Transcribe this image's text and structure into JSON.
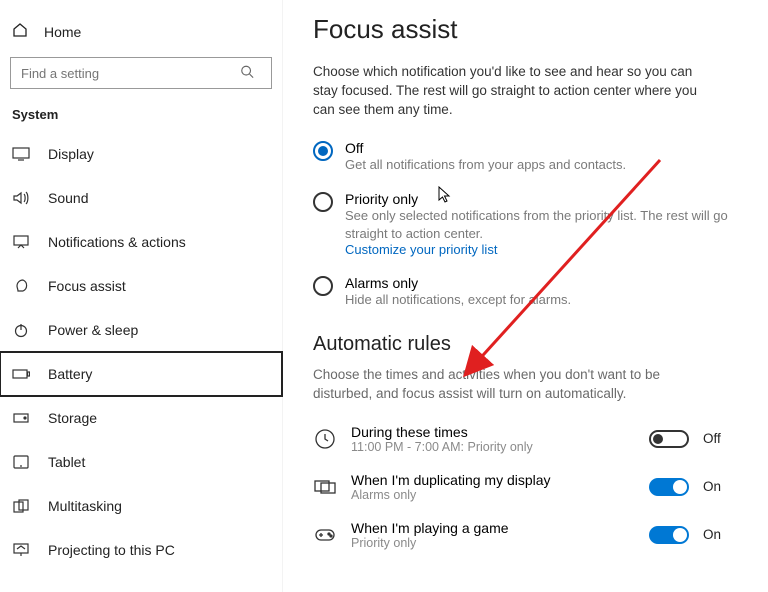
{
  "sidebar": {
    "home": "Home",
    "search_placeholder": "Find a setting",
    "section": "System",
    "items": [
      {
        "id": "display",
        "label": "Display"
      },
      {
        "id": "sound",
        "label": "Sound"
      },
      {
        "id": "notifications",
        "label": "Notifications & actions"
      },
      {
        "id": "focus-assist",
        "label": "Focus assist"
      },
      {
        "id": "power-sleep",
        "label": "Power & sleep"
      },
      {
        "id": "battery",
        "label": "Battery"
      },
      {
        "id": "storage",
        "label": "Storage"
      },
      {
        "id": "tablet",
        "label": "Tablet"
      },
      {
        "id": "multitasking",
        "label": "Multitasking"
      },
      {
        "id": "projecting",
        "label": "Projecting to this PC"
      }
    ],
    "selected": "battery"
  },
  "page": {
    "title": "Focus assist",
    "intro": "Choose which notification you'd like to see and hear so you can stay focused. The rest will go straight to action center where you can see them any time.",
    "radios": {
      "off": {
        "title": "Off",
        "desc": "Get all notifications from your apps and contacts."
      },
      "priority": {
        "title": "Priority only",
        "desc": "See only selected notifications from the priority list. The rest will go straight to action center.",
        "link": "Customize your priority list"
      },
      "alarms": {
        "title": "Alarms only",
        "desc": "Hide all notifications, except for alarms."
      },
      "selected": "off"
    },
    "rules_heading": "Automatic rules",
    "rules_intro": "Choose the times and activities when you don't want to be disturbed, and focus assist will turn on automatically.",
    "rules": {
      "times": {
        "title": "During these times",
        "sub": "11:00 PM - 7:00 AM: Priority only",
        "state": "Off"
      },
      "duplicating": {
        "title": "When I'm duplicating my display",
        "sub": "Alarms only",
        "state": "On"
      },
      "game": {
        "title": "When I'm playing a game",
        "sub": "Priority only",
        "state": "On"
      }
    }
  }
}
